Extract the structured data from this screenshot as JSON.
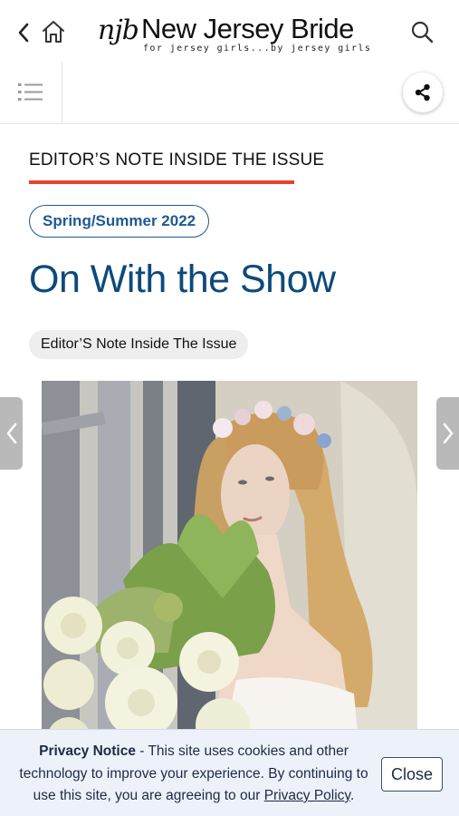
{
  "header": {
    "back_icon": "chevron-left-icon",
    "home_icon": "home-icon",
    "search_icon": "search-icon",
    "logo": {
      "mark": "njb",
      "title": "New Jersey Bride",
      "tagline": "for jersey girls...by jersey girls"
    }
  },
  "subbar": {
    "toc_icon": "list-icon",
    "share_icon": "share-icon"
  },
  "article": {
    "section_label": "EDITOR’S NOTE INSIDE THE ISSUE",
    "issue": "Spring/Summer 2022",
    "title": "On With the Show",
    "category": "Editor’S Note Inside The Issue",
    "accent_color": "#e8412c",
    "title_color": "#0d4a7a"
  },
  "navigation": {
    "prev_icon": "chevron-left-icon",
    "next_icon": "chevron-right-icon"
  },
  "privacy_notice": {
    "heading": "Privacy Notice",
    "text_before_link": " - This site uses cookies and other technology to improve your experience. By continuing to use this site, you are agreeing to our ",
    "link_text": "Privacy Policy",
    "text_after_link": ".",
    "close_label": "Close"
  }
}
